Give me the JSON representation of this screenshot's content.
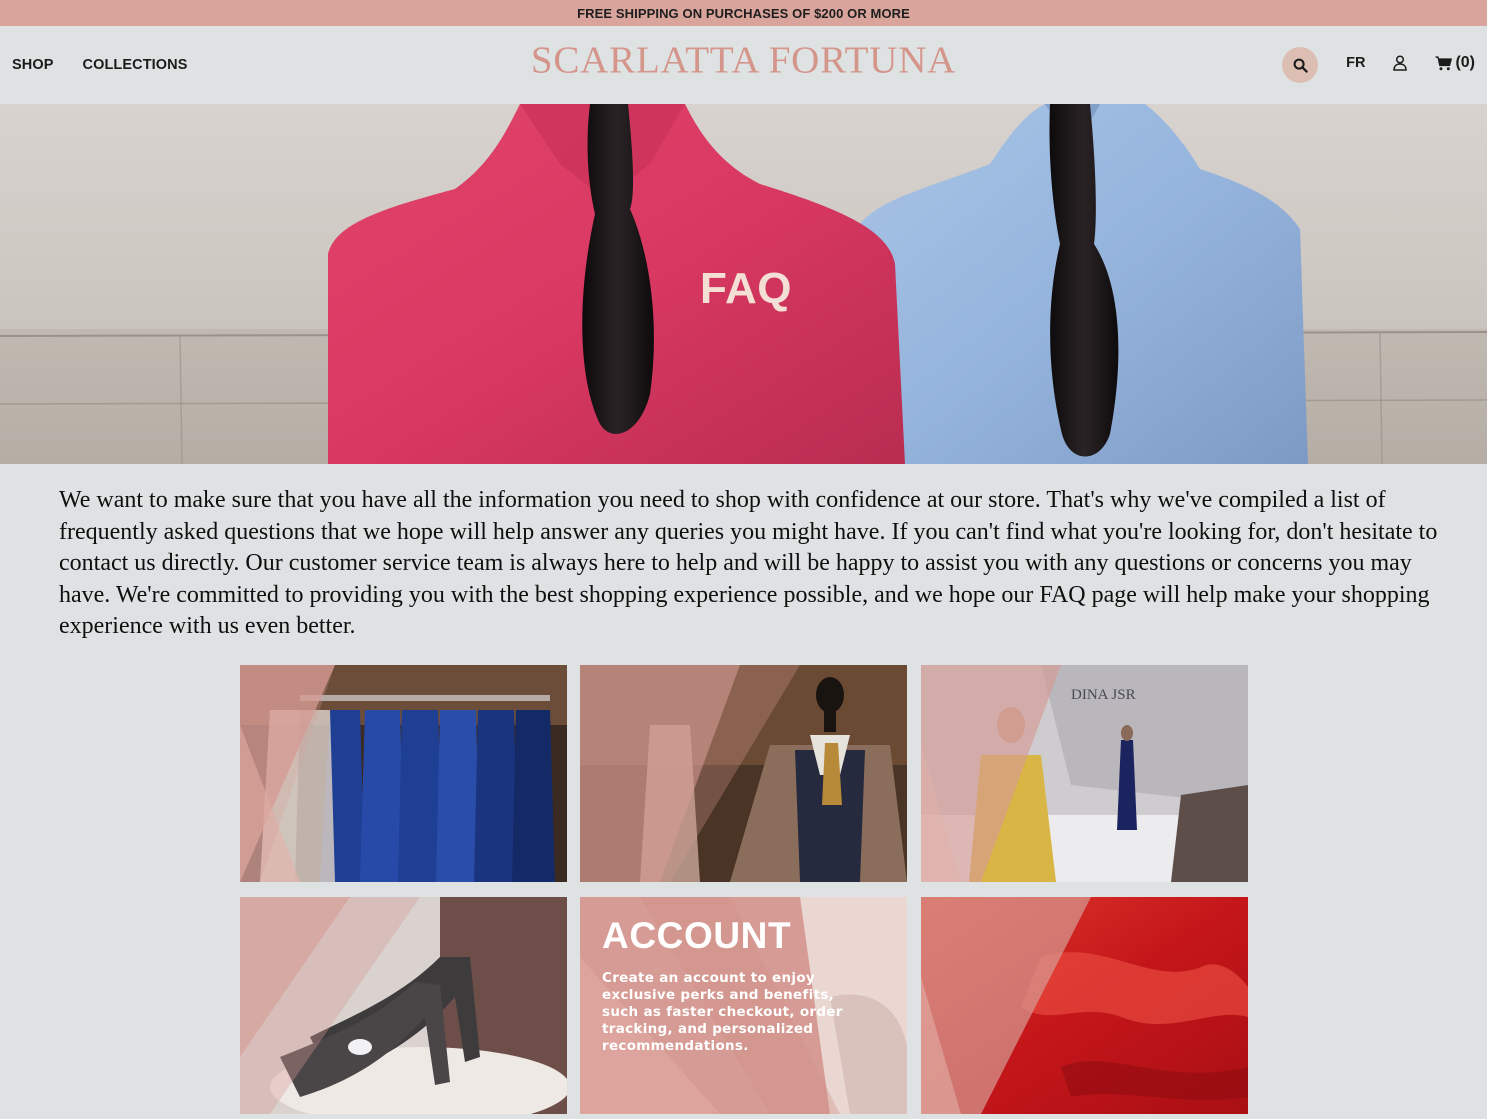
{
  "promo": {
    "text": "FREE SHIPPING ON PURCHASES OF $200 OR MORE"
  },
  "header": {
    "nav": [
      "SHOP",
      "COLLECTIONS"
    ],
    "logo": "SCARLATTA FORTUNA",
    "lang": "FR",
    "cart_label": "(0)",
    "icons": [
      "search-icon",
      "user-icon",
      "cart-icon"
    ]
  },
  "hero": {
    "title": "FAQ"
  },
  "intro": {
    "text": "We want to make sure that you have all the information you need to shop with confidence at our store. That's why we've compiled a list of frequently asked questions that we hope will help answer any queries you might have. If you can't find what you're looking for, don't hesitate to contact us directly. Our customer service team is always here to help and will be happy to assist you with any questions or concerns you may have. We're committed to providing you with the best shopping experience possible, and we hope our FAQ page will help make your shopping experience with us even better."
  },
  "cards": [
    {
      "image": "suits-on-rack"
    },
    {
      "image": "mannequin-in-tweed-jacket"
    },
    {
      "image": "fashion-runway",
      "sign": "DINA JSR"
    },
    {
      "image": "glitter-heels"
    },
    {
      "image": "account-card",
      "title": "ACCOUNT",
      "text": "Create an account to enjoy exclusive perks and benefits, such as faster checkout, order tracking, and personalized recommendations."
    },
    {
      "image": "red-satin-fabric"
    }
  ],
  "colors": {
    "promo": "#d9a49b",
    "logo": "#d4958b",
    "page": "#dfe2e3",
    "card_overlay": "#d69b94",
    "search_bg": "#dcbfb2"
  }
}
